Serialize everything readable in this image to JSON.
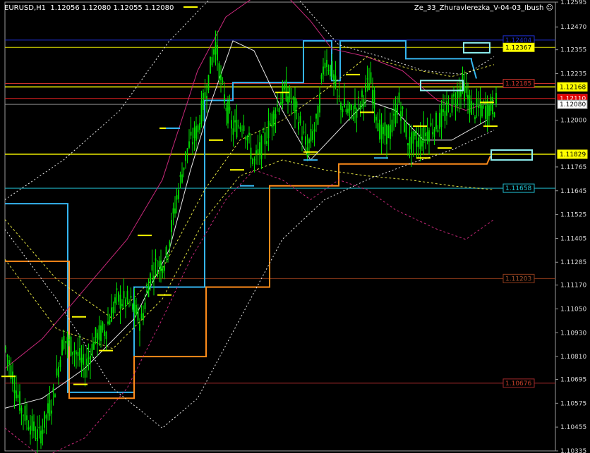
{
  "header": {
    "symbol": "EURUSD,H1",
    "ohlc": "1.12056 1.12080 1.12055 1.12080",
    "indicator": "Ze_33_Zhuravlerezka_V-04-03_Ibush",
    "smiley": "☺"
  },
  "chart_data": {
    "type": "candlestick",
    "ylim": [
      1.10335,
      1.12595
    ],
    "y_ticks": [
      {
        "label": "1.12595",
        "value": 1.12595
      },
      {
        "label": "1.12470",
        "value": 1.1247
      },
      {
        "label": "1.12355",
        "value": 1.12355
      },
      {
        "label": "1.12235",
        "value": 1.12235
      },
      {
        "label": "1.12000",
        "value": 1.12
      },
      {
        "label": "1.11765",
        "value": 1.11765
      },
      {
        "label": "1.11645",
        "value": 1.11645
      },
      {
        "label": "1.11525",
        "value": 1.11525
      },
      {
        "label": "1.11405",
        "value": 1.11405
      },
      {
        "label": "1.11285",
        "value": 1.11285
      },
      {
        "label": "1.11170",
        "value": 1.1117
      },
      {
        "label": "1.11050",
        "value": 1.1105
      },
      {
        "label": "1.10930",
        "value": 1.1093
      },
      {
        "label": "1.10810",
        "value": 1.1081
      },
      {
        "label": "1.10695",
        "value": 1.10695
      },
      {
        "label": "1.10575",
        "value": 1.10575
      },
      {
        "label": "1.10455",
        "value": 1.10455
      },
      {
        "label": "1.10335",
        "value": 1.10335
      }
    ],
    "levels": [
      {
        "label": "1.12404",
        "value": 1.12404,
        "line": "#1f2fd0",
        "text": "#1f2fd0",
        "box": "#000"
      },
      {
        "label": "1.12367",
        "value": 1.12367,
        "line": "#e6e600",
        "text": "#000",
        "box": "#ffff00"
      },
      {
        "label": "1.12185",
        "value": 1.12185,
        "line": "#c8322a",
        "text": "#c8322a",
        "box": "#000"
      },
      {
        "label": "1.12168",
        "value": 1.12168,
        "line": "#ffff00",
        "text": "#000",
        "box": "#ffff00"
      },
      {
        "label": "1.12110",
        "value": 1.1211,
        "line": "#e02020",
        "text": "#fff",
        "box": "#e00000"
      },
      {
        "label": "1.12080",
        "value": 1.1208,
        "line": "#8a8a8a",
        "text": "#000",
        "box": "#ffffff"
      },
      {
        "label": "1.11829",
        "value": 1.11829,
        "line": "#ffff00",
        "text": "#000",
        "box": "#ffff00"
      },
      {
        "label": "1.11658",
        "value": 1.11658,
        "line": "#20b6c8",
        "text": "#20c8d8",
        "box": "#000"
      },
      {
        "label": "1.11203",
        "value": 1.11203,
        "line": "#8b3a1a",
        "text": "#a0522d",
        "box": "#000"
      },
      {
        "label": "1.10676",
        "value": 1.10676,
        "line": "#a0282a",
        "text": "#c8402a",
        "box": "#000"
      }
    ],
    "colors": {
      "candle": "#00e000",
      "blue_step": "#35b5f0",
      "orange_step": "#ff8c1a",
      "yellow_marks": "#ffff00",
      "cyan_boxes": "#8ef0f0",
      "band_white": "#e8e8e8",
      "band_magenta": "#c8287a",
      "band_yellow": "#e0e040"
    }
  }
}
